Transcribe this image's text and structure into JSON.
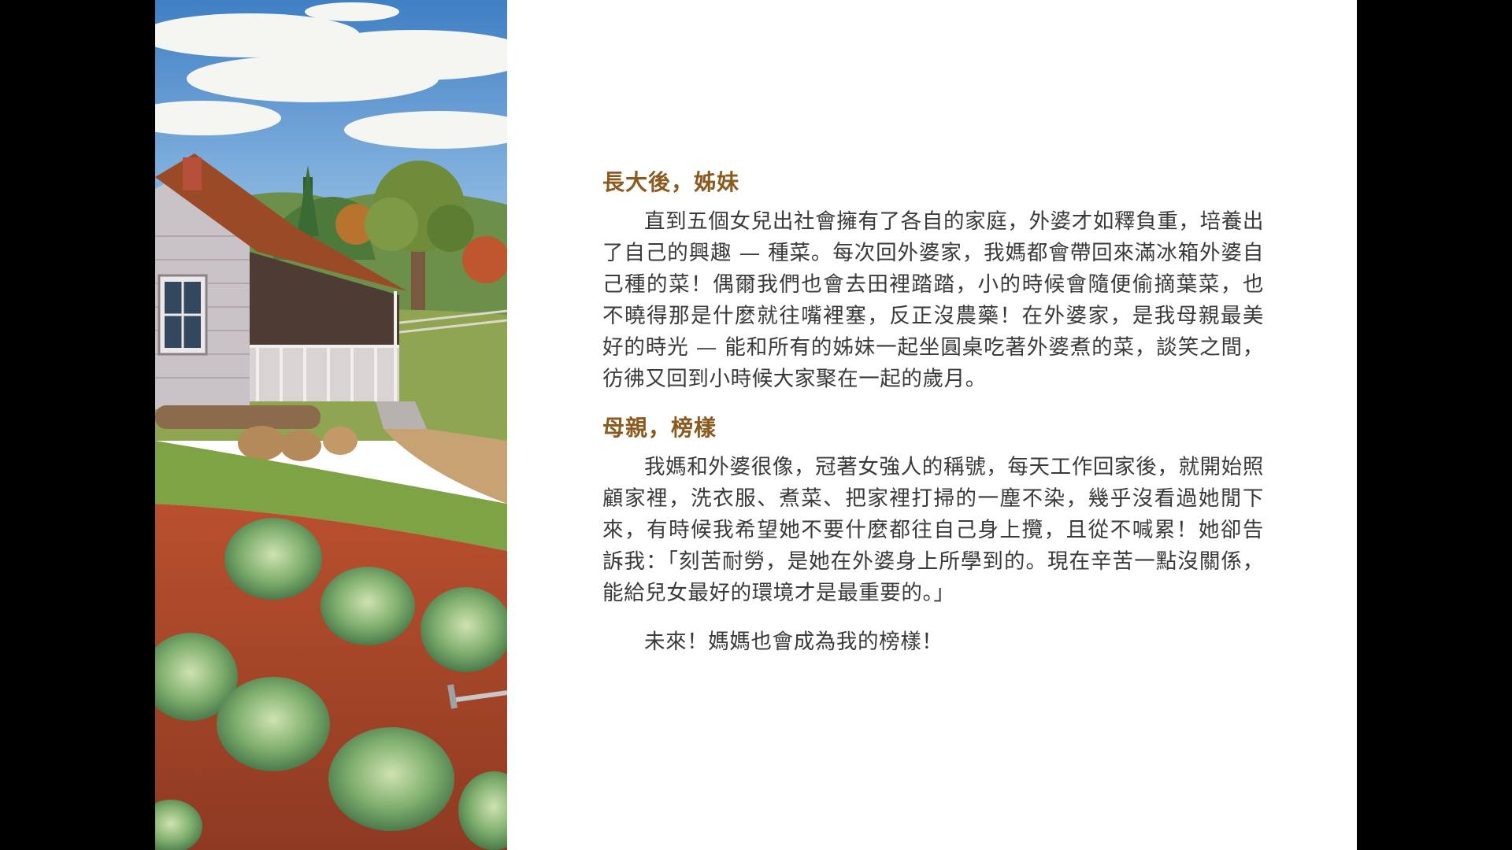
{
  "sections": [
    {
      "heading": "長大後，姊妹",
      "paragraph": "直到五個女兒出社會擁有了各自的家庭，外婆才如釋負重，培養出了自己的興趣 — 種菜。每次回外婆家，我媽都會帶回來滿冰箱外婆自己種的菜！偶爾我們也會去田裡踏踏，小的時候會隨便偷摘葉菜，也不曉得那是什麼就往嘴裡塞，反正沒農藥！在外婆家，是我母親最美好的時光 — 能和所有的姊妹一起坐圓桌吃著外婆煮的菜，談笑之間，彷彿又回到小時候大家聚在一起的歲月。"
    },
    {
      "heading": "母親，榜樣",
      "paragraph": "我媽和外婆很像，冠著女強人的稱號，每天工作回家後，就開始照顧家裡，洗衣服、煮菜、把家裡打掃的一塵不染，幾乎沒看過她閒下來，有時候我希望她不要什麼都往自己身上攬，且從不喊累！她卻告訴我：「刻苦耐勞，是她在外婆身上所學到的。現在辛苦一點沒關係，能給兒女最好的環境才是最重要的。」"
    }
  ],
  "closing": "未來！媽媽也會成為我的榜樣！",
  "colors": {
    "heading": "#8a5a1e",
    "body_text": "#3a3a3a",
    "page_background": "#ffffff",
    "letterbox": "#000000"
  }
}
